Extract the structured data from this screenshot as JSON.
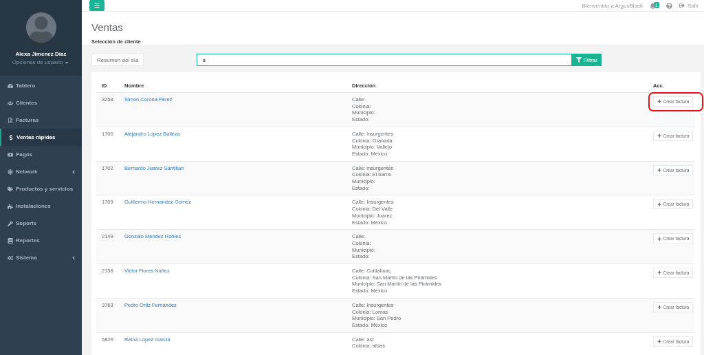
{
  "sidebar": {
    "user": {
      "name": "Alexa Jimenez Díaz",
      "options": "Opciones de usuario"
    },
    "items": [
      {
        "label": "Tablero",
        "selected": false,
        "has_submenu": false
      },
      {
        "label": "Clientes",
        "selected": false,
        "has_submenu": false
      },
      {
        "label": "Facturas",
        "selected": false,
        "has_submenu": false
      },
      {
        "label": "Ventas rápidas",
        "selected": true,
        "has_submenu": false
      },
      {
        "label": "Pagos",
        "selected": false,
        "has_submenu": false
      },
      {
        "label": "Network",
        "selected": false,
        "has_submenu": true
      },
      {
        "label": "Productos y servicios",
        "selected": false,
        "has_submenu": false
      },
      {
        "label": "Instalaciones",
        "selected": false,
        "has_submenu": false
      },
      {
        "label": "Soporte",
        "selected": false,
        "has_submenu": false
      },
      {
        "label": "Reportes",
        "selected": false,
        "has_submenu": false
      },
      {
        "label": "Sistema",
        "selected": false,
        "has_submenu": true
      }
    ]
  },
  "header": {
    "welcome": "Bienvenido a ArgusBlack",
    "notifications": "1",
    "logout": "Salir"
  },
  "page": {
    "title": "Ventas",
    "subtitle": "Selección de cliente"
  },
  "toolbar": {
    "summary_button": "Resumen del día",
    "search": {
      "value": "a"
    },
    "filter_button": "Filtrar"
  },
  "table": {
    "columns": [
      "ID",
      "Nombre",
      "Dirección",
      "Acc."
    ],
    "rows": [
      {
        "id": "3258",
        "name": "Simón Corona Pérez",
        "address": [
          "Calle:",
          "Colónia:",
          "Municipio:",
          "Estado:"
        ],
        "action": "Crear factura",
        "highlighted": true
      },
      {
        "id": "1700",
        "name": "Alejandro López Balleza",
        "address": [
          "Calle: insurgentes",
          "Colónia: Granada",
          "Municipio: Vallejo",
          "Estado: Mexico"
        ],
        "action": "Crear factura",
        "highlighted": false
      },
      {
        "id": "1702",
        "name": "Bernardo Juarez Santillan",
        "address": [
          "Calle: insurgentes",
          "Colónia: El barrio",
          "Municipio:",
          "Estado:"
        ],
        "action": "Crear factura",
        "highlighted": false
      },
      {
        "id": "1709",
        "name": "Guillermo Hernandez Gomez",
        "address": [
          "Calle: Insurgentes",
          "Colónia: Del Valle",
          "Municipio: Juarez",
          "Estado: México"
        ],
        "action": "Crear factura",
        "highlighted": false
      },
      {
        "id": "2149",
        "name": "Gonzalo Mendez Robles",
        "address": [
          "Calle:",
          "Colónia:",
          "Municipio:",
          "Estado:"
        ],
        "action": "Crear factura",
        "highlighted": false
      },
      {
        "id": "2158",
        "name": "Victor Flores Núñez",
        "address": [
          "Calle: Cuitlahuac",
          "Colónia: San Martín de las Pirámides",
          "Municipio: San Martín de las Pirámides",
          "Estado: México"
        ],
        "action": "Crear factura",
        "highlighted": false
      },
      {
        "id": "3763",
        "name": "Pedro Ortiz Fernández",
        "address": [
          "Calle: Insurgentes",
          "Colónia: Lomas",
          "Municipio: San Pedro",
          "Estado: México"
        ],
        "action": "Crear factura",
        "highlighted": false
      },
      {
        "id": "5829",
        "name": "Reina López García",
        "address": [
          "Calle: asf",
          "Colónia: afdas"
        ],
        "action": "Crear factura",
        "highlighted": false
      }
    ]
  }
}
